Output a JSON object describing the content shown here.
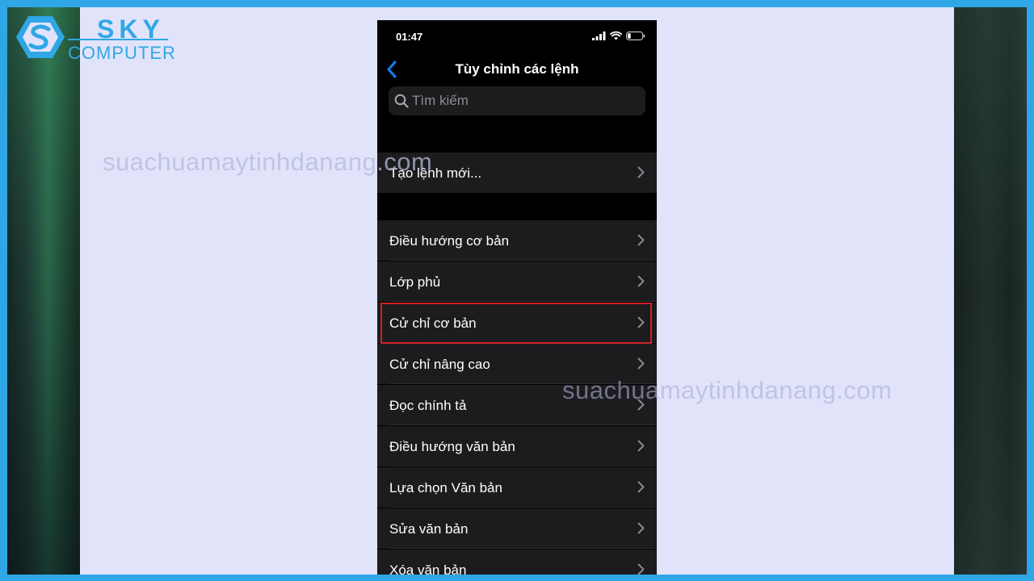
{
  "brand": {
    "name_top": "SKY",
    "name_bottom": "COMPUTER",
    "color": "#2fa7e6"
  },
  "watermark": {
    "text": "suachuamaytinhdanang.com"
  },
  "phone": {
    "status_bar": {
      "time": "01:47",
      "icons": [
        "signal-icon",
        "wifi-icon",
        "battery-icon"
      ]
    },
    "nav": {
      "back_icon": "chevron-left-icon",
      "title": "Tùy chỉnh các lệnh"
    },
    "search": {
      "placeholder": "Tìm kiếm"
    },
    "group1": [
      {
        "label": "Tạo lệnh mới..."
      }
    ],
    "group2": [
      {
        "label": "Điều hướng cơ bản"
      },
      {
        "label": "Lớp phủ"
      },
      {
        "label": "Cử chỉ cơ bản",
        "highlighted": true
      },
      {
        "label": "Cử chỉ nâng cao"
      },
      {
        "label": "Đọc chính tả"
      },
      {
        "label": "Điều hướng văn bản"
      },
      {
        "label": "Lựa chọn Văn bản"
      },
      {
        "label": "Sửa văn bản"
      },
      {
        "label": "Xóa văn bản"
      }
    ]
  },
  "colors": {
    "highlight": "#d0202a",
    "accent": "#0a84ff",
    "cell": "#1c1c1e",
    "background": "#000000"
  }
}
